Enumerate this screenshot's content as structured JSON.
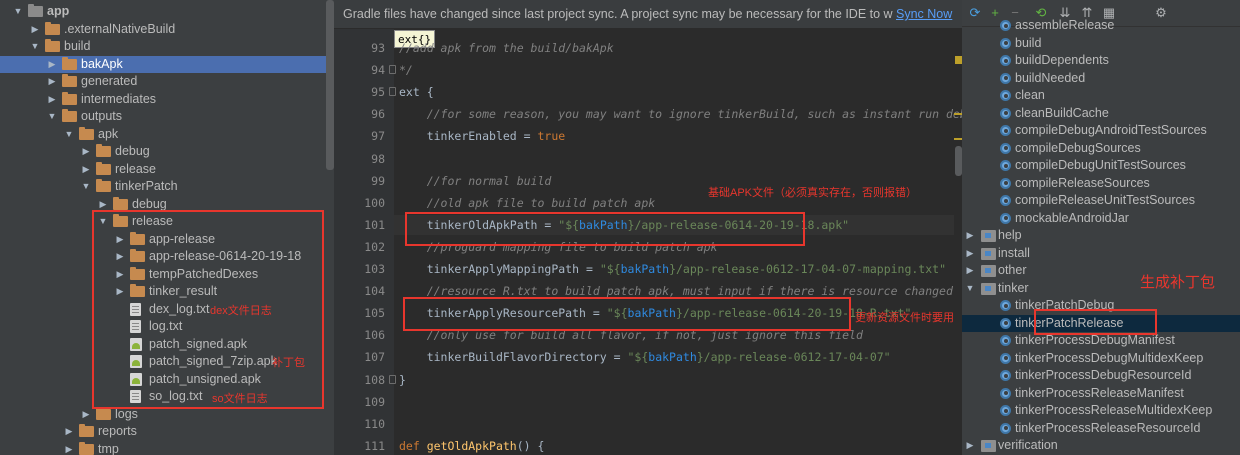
{
  "project_tree": {
    "items": [
      {
        "label": "app",
        "arrow": "▼",
        "icon": "root",
        "bold": true
      },
      {
        "label": ".externalNativeBuild",
        "arrow": "▶",
        "icon": "folder"
      },
      {
        "label": "build",
        "arrow": "▼",
        "icon": "folder"
      },
      {
        "label": "bakApk",
        "arrow": "▶",
        "icon": "folder",
        "selected": true
      },
      {
        "label": "generated",
        "arrow": "▶",
        "icon": "folder"
      },
      {
        "label": "intermediates",
        "arrow": "▶",
        "icon": "folder"
      },
      {
        "label": "outputs",
        "arrow": "▼",
        "icon": "folder"
      },
      {
        "label": "apk",
        "arrow": "▼",
        "icon": "folder"
      },
      {
        "label": "debug",
        "arrow": "▶",
        "icon": "folder"
      },
      {
        "label": "release",
        "arrow": "▶",
        "icon": "folder"
      },
      {
        "label": "tinkerPatch",
        "arrow": "▼",
        "icon": "folder"
      },
      {
        "label": "debug",
        "arrow": "▶",
        "icon": "folder"
      },
      {
        "label": "release",
        "arrow": "▼",
        "icon": "folder"
      },
      {
        "label": "app-release",
        "arrow": "▶",
        "icon": "folder"
      },
      {
        "label": "app-release-0614-20-19-18",
        "arrow": "▶",
        "icon": "folder"
      },
      {
        "label": "tempPatchedDexes",
        "arrow": "▶",
        "icon": "folder"
      },
      {
        "label": "tinker_result",
        "arrow": "▶",
        "icon": "folder"
      },
      {
        "label": "dex_log.txt",
        "arrow": "",
        "icon": "file"
      },
      {
        "label": "log.txt",
        "arrow": "",
        "icon": "file"
      },
      {
        "label": "patch_signed.apk",
        "arrow": "",
        "icon": "apk"
      },
      {
        "label": "patch_signed_7zip.apk",
        "arrow": "",
        "icon": "apk"
      },
      {
        "label": "patch_unsigned.apk",
        "arrow": "",
        "icon": "apk"
      },
      {
        "label": "so_log.txt",
        "arrow": "",
        "icon": "file"
      },
      {
        "label": "logs",
        "arrow": "▶",
        "icon": "folder"
      },
      {
        "label": "reports",
        "arrow": "▶",
        "icon": "folder"
      },
      {
        "label": "tmp",
        "arrow": "▶",
        "icon": "folder"
      }
    ],
    "annotations": {
      "dex_log": "dex文件日志",
      "patch": "补丁包",
      "so_log": "so文件日志"
    }
  },
  "editor": {
    "sync_message": "Gradle files have changed since last project sync. A project sync may be necessary for the IDE to work pro...",
    "sync_link": "Sync Now",
    "breadcrumb_popup": "ext{}",
    "lines": [
      {
        "num": "93",
        "text": "//add apk from the build/bakApk",
        "type": "comment"
      },
      {
        "num": "94",
        "text": "*/",
        "type": "comment"
      },
      {
        "num": "95",
        "text": "ext {",
        "type": "plain"
      },
      {
        "num": "96",
        "text": "    //for some reason, you may want to ignore tinkerBuild, such as instant run debug build?",
        "type": "comment"
      },
      {
        "num": "97",
        "text": "",
        "type": "plain"
      },
      {
        "num": "98",
        "text": "",
        "type": "plain"
      },
      {
        "num": "99",
        "text": "    //for normal build",
        "type": "comment"
      },
      {
        "num": "100",
        "text": "    //old apk file to build patch apk",
        "type": "comment"
      },
      {
        "num": "101",
        "text": "",
        "type": "plain"
      },
      {
        "num": "102",
        "text": "    //proguard mapping file to build patch apk",
        "type": "comment"
      },
      {
        "num": "103",
        "text": "",
        "type": "plain"
      },
      {
        "num": "104",
        "text": "    //resource R.txt to build patch apk, must input if there is resource changed",
        "type": "comment"
      },
      {
        "num": "105",
        "text": "",
        "type": "plain"
      },
      {
        "num": "106",
        "text": "    //only use for build all flavor, if not, just ignore this field",
        "type": "comment"
      },
      {
        "num": "107",
        "text": "",
        "type": "plain"
      },
      {
        "num": "108",
        "text": "}",
        "type": "plain"
      },
      {
        "num": "109",
        "text": "",
        "type": "plain"
      },
      {
        "num": "110",
        "text": "",
        "type": "plain"
      },
      {
        "num": "111",
        "text": "",
        "type": "plain"
      }
    ],
    "code": {
      "tinker_enabled_key": "tinkerEnabled",
      "tinker_enabled_op": " = ",
      "tinker_enabled_val": "true",
      "old_apk_key": "tinkerOldApkPath",
      "old_apk_prefix": "\"${",
      "old_apk_var": "bakPath",
      "old_apk_suffix": "}/app-release-0614-20-19-18.apk\"",
      "mapping_key": "tinkerApplyMappingPath",
      "mapping_prefix": "\"${",
      "mapping_var": "bakPath",
      "mapping_suffix": "}/app-release-0612-17-04-07-mapping.txt\"",
      "resource_key": "tinkerApplyResourcePath",
      "resource_prefix": "\"${",
      "resource_var": "bakPath",
      "resource_suffix": "}/app-release-0614-20-19-18-R.txt\"",
      "flavor_key": "tinkerBuildFlavorDirectory",
      "flavor_prefix": "\"${",
      "flavor_var": "bakPath",
      "flavor_suffix": "}/app-release-0612-17-04-07\"",
      "def_kw": "def",
      "def_fn": "getOldApkPath",
      "def_rest": "() {",
      "eq": " = "
    },
    "annotations": {
      "base_apk": "基础APK文件（必须真实存在，否则报错）",
      "resource_update": "更新资源文件时要用"
    }
  },
  "gradle": {
    "tasks": [
      {
        "label": "assembleRelease",
        "type": "task"
      },
      {
        "label": "build",
        "type": "task"
      },
      {
        "label": "buildDependents",
        "type": "task"
      },
      {
        "label": "buildNeeded",
        "type": "task"
      },
      {
        "label": "clean",
        "type": "task"
      },
      {
        "label": "cleanBuildCache",
        "type": "task"
      },
      {
        "label": "compileDebugAndroidTestSources",
        "type": "task"
      },
      {
        "label": "compileDebugSources",
        "type": "task"
      },
      {
        "label": "compileDebugUnitTestSources",
        "type": "task"
      },
      {
        "label": "compileReleaseSources",
        "type": "task"
      },
      {
        "label": "compileReleaseUnitTestSources",
        "type": "task"
      },
      {
        "label": "mockableAndroidJar",
        "type": "task"
      },
      {
        "label": "help",
        "type": "group",
        "arrow": "▶"
      },
      {
        "label": "install",
        "type": "group",
        "arrow": "▶"
      },
      {
        "label": "other",
        "type": "group",
        "arrow": "▶"
      },
      {
        "label": "tinker",
        "type": "group",
        "arrow": "▼"
      },
      {
        "label": "tinkerPatchDebug",
        "type": "task"
      },
      {
        "label": "tinkerPatchRelease",
        "type": "task",
        "selected": true
      },
      {
        "label": "tinkerProcessDebugManifest",
        "type": "task"
      },
      {
        "label": "tinkerProcessDebugMultidexKeep",
        "type": "task"
      },
      {
        "label": "tinkerProcessDebugResourceId",
        "type": "task"
      },
      {
        "label": "tinkerProcessReleaseManifest",
        "type": "task"
      },
      {
        "label": "tinkerProcessReleaseMultidexKeep",
        "type": "task"
      },
      {
        "label": "tinkerProcessReleaseResourceId",
        "type": "task"
      },
      {
        "label": "verification",
        "type": "group",
        "arrow": "▶"
      }
    ],
    "annotation": "生成补丁包",
    "toolbar_icons": [
      "refresh-icon",
      "add-icon",
      "remove-icon",
      "sync-icon",
      "expand-all-icon",
      "collapse-all-icon",
      "group-icon",
      "settings-icon"
    ]
  },
  "colors": {
    "accent_red": "#e8362d",
    "selection": "#4b6eaf",
    "link": "#589df6"
  }
}
